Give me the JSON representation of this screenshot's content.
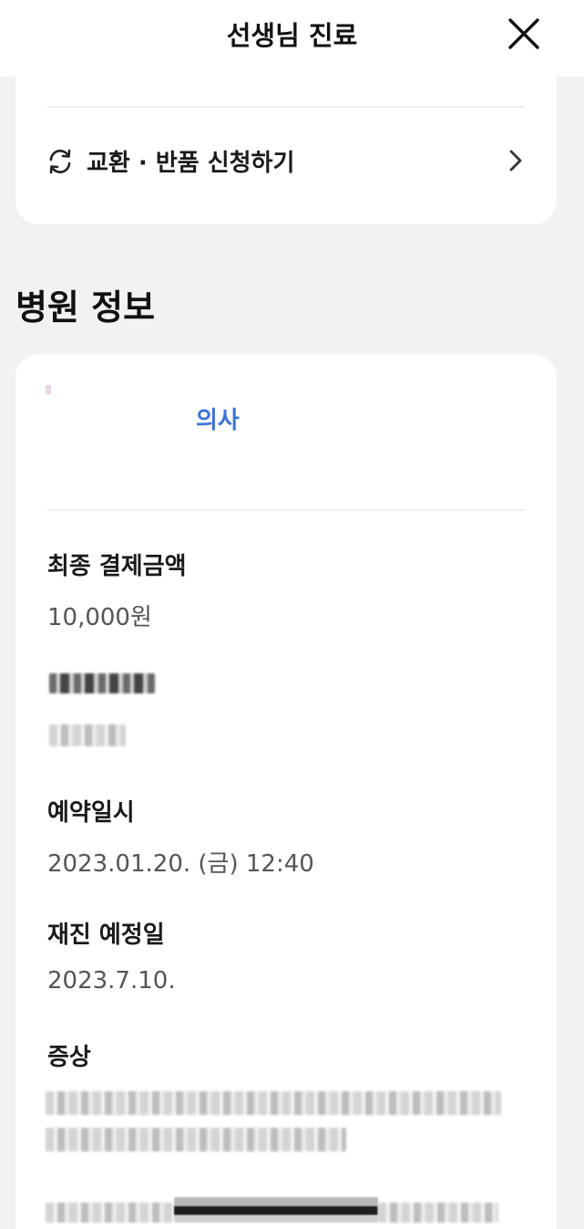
{
  "header": {
    "title": "선생님 진료",
    "close_icon": "close-icon"
  },
  "order_card": {
    "exchange_label": "교환 · 반품 신청하기",
    "exchange_icon": "refresh-icon",
    "chevron_icon": "chevron-right-icon"
  },
  "hospital": {
    "section_title": "병원 정보",
    "doctor_role": "의사",
    "fields": [
      {
        "label": "최종 결제금액",
        "value": "10,000원"
      },
      {
        "label": "예약일시",
        "value": "2023.01.20. (금) 12:40"
      },
      {
        "label": "재진 예정일",
        "value": "2023.7.10."
      },
      {
        "label": "증상",
        "value": ""
      }
    ]
  },
  "colors": {
    "accent_blue": "#3b74d2",
    "background": "#f2f2f4",
    "card": "#ffffff"
  }
}
